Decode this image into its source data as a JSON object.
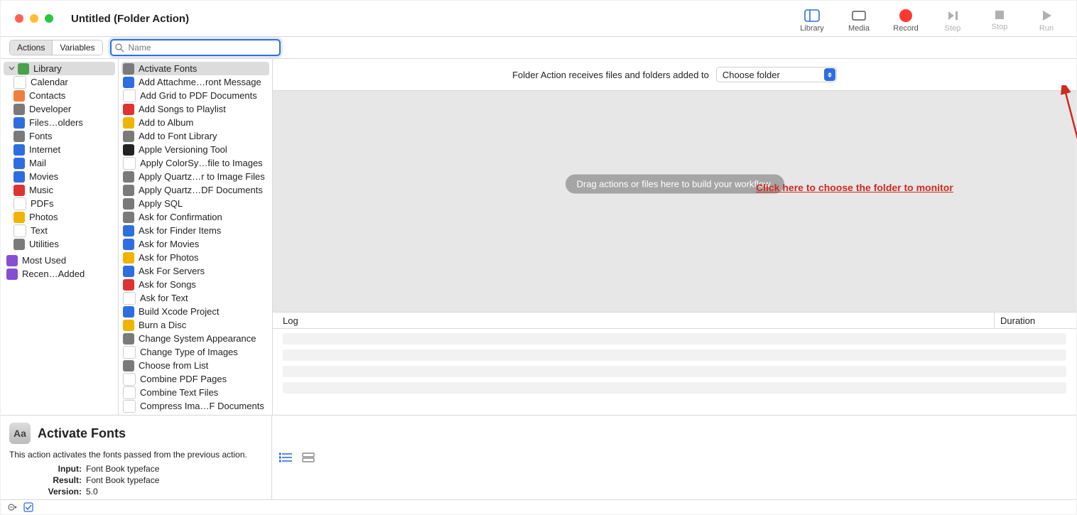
{
  "window_title": "Untitled (Folder Action)",
  "toolbar_buttons": {
    "library": "Library",
    "media": "Media",
    "record": "Record",
    "step": "Step",
    "stop": "Stop",
    "run": "Run"
  },
  "subbar": {
    "seg_actions": "Actions",
    "seg_variables": "Variables",
    "search_placeholder": "Name"
  },
  "categories": [
    {
      "icon": "library-icon",
      "color": "ic-g",
      "label": "Library",
      "sel": true,
      "top": true
    },
    {
      "icon": "calendar-icon",
      "color": "ic-w",
      "label": "Calendar"
    },
    {
      "icon": "contacts-icon",
      "color": "ic-a",
      "label": "Contacts"
    },
    {
      "icon": "developer-icon",
      "color": "ic-d",
      "label": "Developer"
    },
    {
      "icon": "files-icon",
      "color": "ic-c",
      "label": "Files…olders"
    },
    {
      "icon": "fonts-icon",
      "color": "ic-d",
      "label": "Fonts"
    },
    {
      "icon": "internet-icon",
      "color": "ic-c",
      "label": "Internet"
    },
    {
      "icon": "mail-icon",
      "color": "ic-c",
      "label": "Mail"
    },
    {
      "icon": "movies-icon",
      "color": "ic-c",
      "label": "Movies"
    },
    {
      "icon": "music-icon",
      "color": "ic-e",
      "label": "Music"
    },
    {
      "icon": "pdfs-icon",
      "color": "ic-w",
      "label": "PDFs"
    },
    {
      "icon": "photos-icon",
      "color": "ic-f",
      "label": "Photos"
    },
    {
      "icon": "text-icon",
      "color": "ic-w",
      "label": "Text"
    },
    {
      "icon": "utilities-icon",
      "color": "ic-d",
      "label": "Utilities"
    }
  ],
  "smart_categories": [
    {
      "icon": "smart-icon",
      "color": "ic-b",
      "label": "Most Used"
    },
    {
      "icon": "smart-icon",
      "color": "ic-b",
      "label": "Recen…Added"
    }
  ],
  "actions": [
    {
      "label": "Activate Fonts",
      "sel": true,
      "color": "ic-d"
    },
    {
      "label": "Add Attachme…ront Message",
      "color": "ic-c"
    },
    {
      "label": "Add Grid to PDF Documents",
      "color": "ic-w"
    },
    {
      "label": "Add Songs to Playlist",
      "color": "ic-e"
    },
    {
      "label": "Add to Album",
      "color": "ic-f"
    },
    {
      "label": "Add to Font Library",
      "color": "ic-d"
    },
    {
      "label": "Apple Versioning Tool",
      "color": "ic-h"
    },
    {
      "label": "Apply ColorSy…file to Images",
      "color": "ic-w"
    },
    {
      "label": "Apply Quartz…r to Image Files",
      "color": "ic-d"
    },
    {
      "label": "Apply Quartz…DF Documents",
      "color": "ic-d"
    },
    {
      "label": "Apply SQL",
      "color": "ic-d"
    },
    {
      "label": "Ask for Confirmation",
      "color": "ic-d"
    },
    {
      "label": "Ask for Finder Items",
      "color": "ic-c"
    },
    {
      "label": "Ask for Movies",
      "color": "ic-c"
    },
    {
      "label": "Ask for Photos",
      "color": "ic-f"
    },
    {
      "label": "Ask For Servers",
      "color": "ic-c"
    },
    {
      "label": "Ask for Songs",
      "color": "ic-e"
    },
    {
      "label": "Ask for Text",
      "color": "ic-w"
    },
    {
      "label": "Build Xcode Project",
      "color": "ic-c"
    },
    {
      "label": "Burn a Disc",
      "color": "ic-f"
    },
    {
      "label": "Change System Appearance",
      "color": "ic-d"
    },
    {
      "label": "Change Type of Images",
      "color": "ic-w"
    },
    {
      "label": "Choose from List",
      "color": "ic-d"
    },
    {
      "label": "Combine PDF Pages",
      "color": "ic-w"
    },
    {
      "label": "Combine Text Files",
      "color": "ic-w"
    },
    {
      "label": "Compress Ima…F Documents",
      "color": "ic-w"
    }
  ],
  "right_header": {
    "prefix": "Folder Action receives files and folders added to",
    "dropdown": "Choose folder"
  },
  "workflow_placeholder": "Drag actions or files here to build your workflow.",
  "annotation": "Click here to choose the folder to monitor",
  "log": {
    "log": "Log",
    "duration": "Duration"
  },
  "info": {
    "title": "Activate Fonts",
    "desc": "This action activates the fonts passed from the previous action.",
    "input_label": "Input:",
    "input_value": "Font Book typeface",
    "result_label": "Result:",
    "result_value": "Font Book typeface",
    "version_label": "Version:",
    "version_value": "5.0"
  }
}
